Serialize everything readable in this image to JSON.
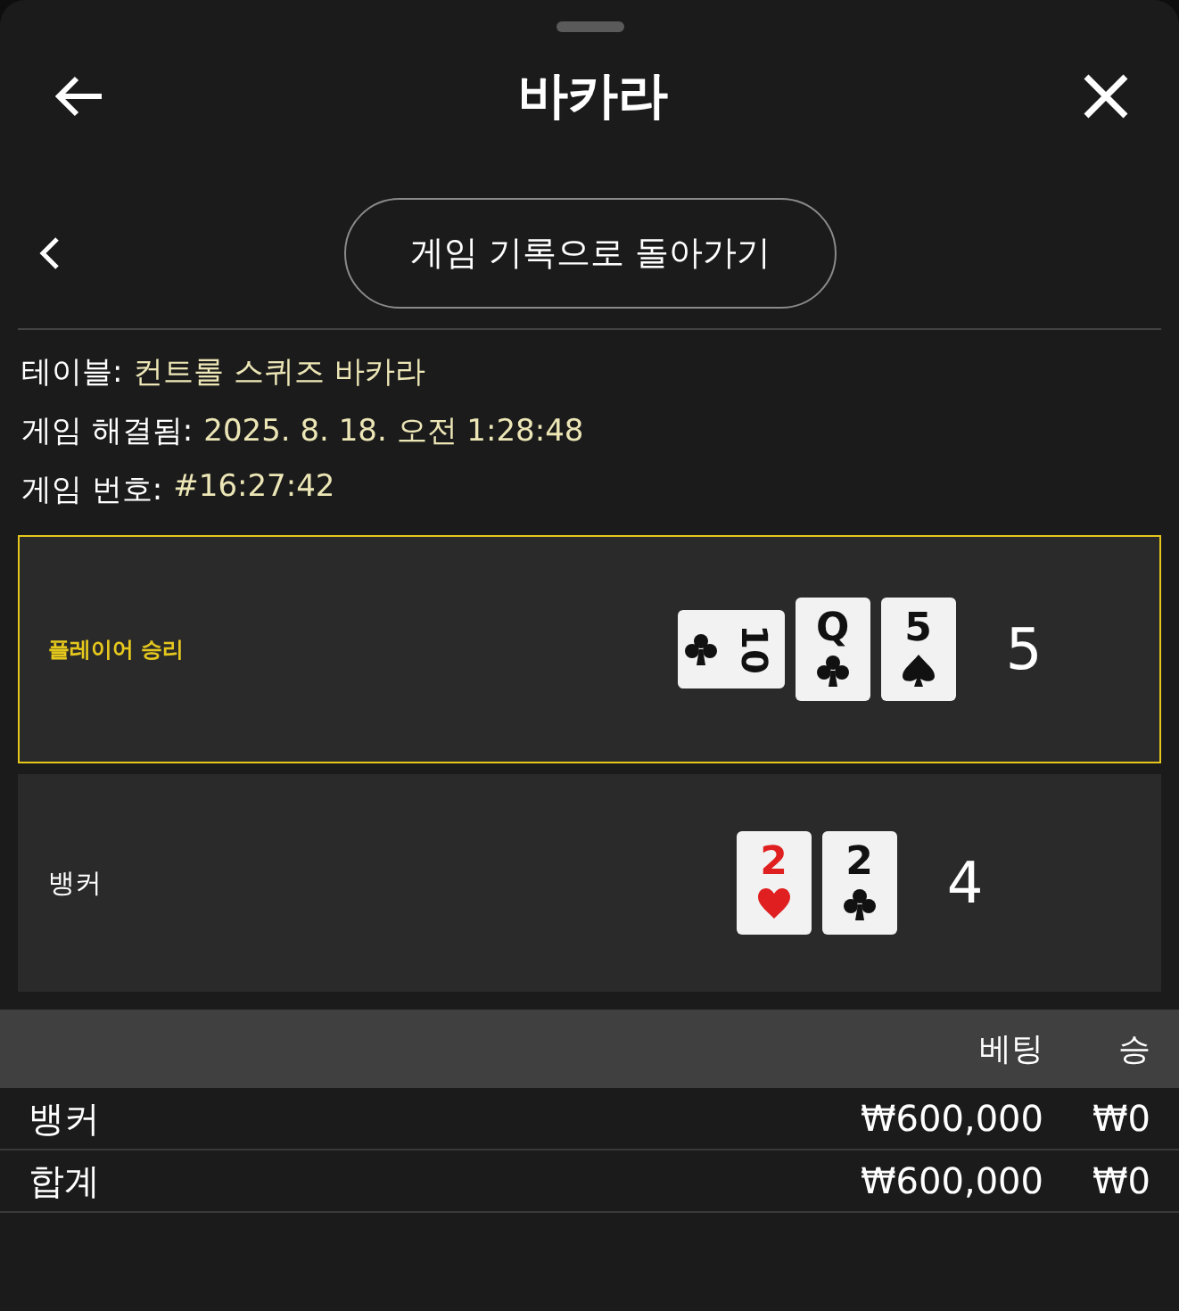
{
  "header": {
    "title": "바카라"
  },
  "back_button": {
    "label": "게임 기록으로 돌아가기"
  },
  "info": [
    {
      "label": "테이블:",
      "value": "컨트롤 스퀴즈 바카라"
    },
    {
      "label": "게임 해결됨:",
      "value": "2025. 8. 18. 오전 1:28:48"
    },
    {
      "label": "게임 번호:",
      "value": "#16:27:42"
    }
  ],
  "hands": [
    {
      "label": "플레이어 승리",
      "winner": true,
      "total": "5",
      "cards": [
        {
          "rank": "10",
          "kind": "clubs",
          "sideways": true
        },
        {
          "rank": "Q",
          "kind": "clubs",
          "sideways": false
        },
        {
          "rank": "5",
          "kind": "spades",
          "sideways": false
        }
      ]
    },
    {
      "label": "뱅커",
      "winner": false,
      "total": "4",
      "cards": [
        {
          "rank": "2",
          "kind": "hearts",
          "sideways": false
        },
        {
          "rank": "2",
          "kind": "clubs",
          "sideways": false
        }
      ]
    }
  ],
  "table": {
    "columns": [
      "",
      "베팅",
      "승"
    ],
    "rows": [
      {
        "cells": [
          "뱅커",
          "₩600,000",
          "₩0"
        ]
      },
      {
        "cells": [
          "합계",
          "₩600,000",
          "₩0"
        ]
      }
    ]
  }
}
